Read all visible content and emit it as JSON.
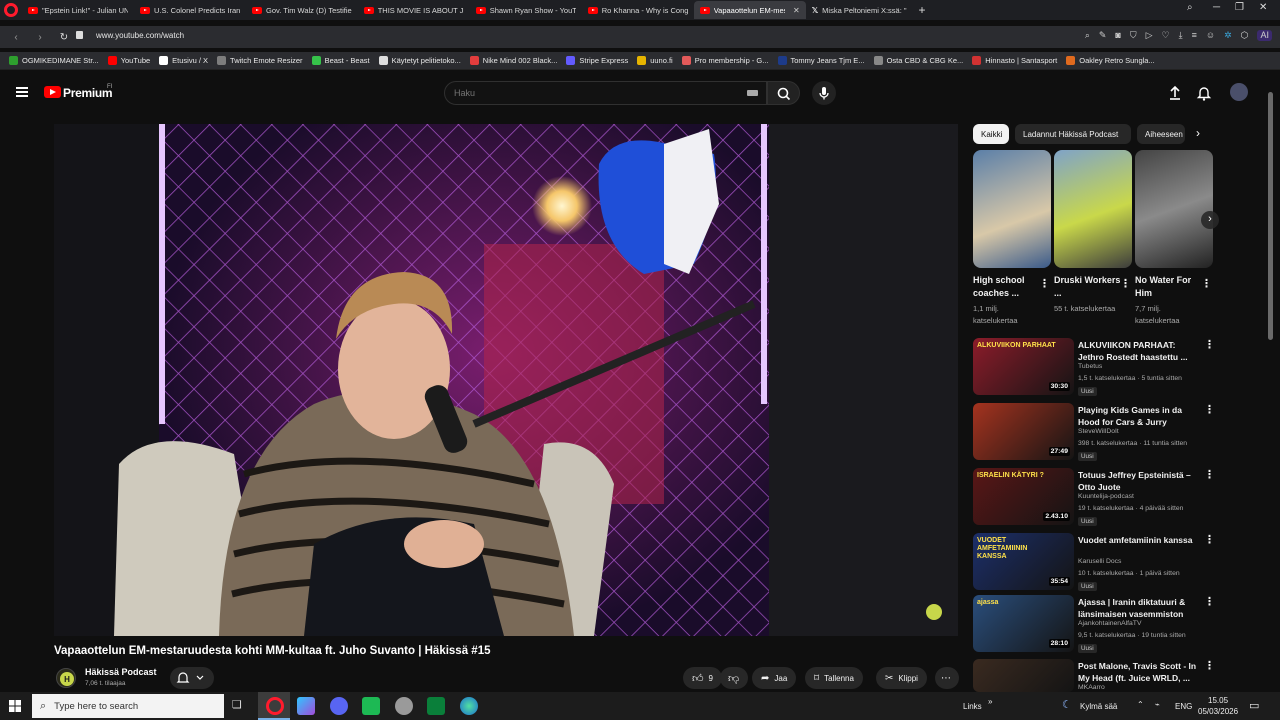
{
  "browser": {
    "tabs": [
      {
        "label": "\"Epstein Link!\" - Julian UN",
        "kind": "youtube"
      },
      {
        "label": "U.S. Colonel Predicts Iran",
        "kind": "youtube"
      },
      {
        "label": "Gov. Tim Walz (D) Testifie",
        "kind": "youtube"
      },
      {
        "label": "THIS MOVIE IS ABOUT JEF",
        "kind": "youtube"
      },
      {
        "label": "Shawn Ryan Show - YouT",
        "kind": "youtube"
      },
      {
        "label": "Ro Khanna - Why is Cong",
        "kind": "youtube"
      },
      {
        "label": "Vapaaottelun EM-mes",
        "kind": "youtube",
        "active": true
      },
      {
        "label": "Miska Peltoniemi X:ssä: \"",
        "kind": "x"
      }
    ],
    "url": "www.youtube.com/watch",
    "new_tab": "+",
    "ai_label": "AI",
    "bookmarks": [
      {
        "label": "OGMIKEDIMANE Str...",
        "color": "#2e9f2e"
      },
      {
        "label": "YouTube",
        "color": "#ff0000"
      },
      {
        "label": "Etusivu / X",
        "color": "#ffffff"
      },
      {
        "label": "Twitch Emote Resizer",
        "color": "#7d7d7d"
      },
      {
        "label": "Beast - Beast",
        "color": "#36c24a"
      },
      {
        "label": "Käytetyt pelitietoko...",
        "color": "#dddddd"
      },
      {
        "label": "Nike Mind 002 Black...",
        "color": "#e23d3d"
      },
      {
        "label": "Stripe Express",
        "color": "#635bff"
      },
      {
        "label": "uuno.fi",
        "color": "#e6b400"
      },
      {
        "label": "Pro membership - G...",
        "color": "#e35a5a"
      },
      {
        "label": "Tommy Jeans Tjm E...",
        "color": "#1d3b8a"
      },
      {
        "label": "Osta CBD & CBG Ke...",
        "color": "#888888"
      },
      {
        "label": "Hinnasto | Santasport",
        "color": "#d13232"
      },
      {
        "label": "Oakley Retro Sungla...",
        "color": "#e06a1e"
      }
    ]
  },
  "youtube": {
    "brand": "Premium",
    "brand_region": "FI",
    "search_placeholder": "Haku"
  },
  "video": {
    "title": "Vapaaottelun EM-mestaruudesta kohti MM-kultaa ft. Juho Suvanto | Häkissä #15",
    "channel": "Häkissä Podcast",
    "subscribers": "7,06 t. tilaajaa",
    "likes": "9",
    "share": "Jaa",
    "save": "Tallenna",
    "clip": "Klippi"
  },
  "chips": [
    {
      "label": "Kaikki",
      "selected": true
    },
    {
      "label": "Ladannut Häkissä Podcast",
      "selected": false
    },
    {
      "label": "Aiheeseen",
      "selected": false
    }
  ],
  "shorts": [
    {
      "title": "High school coaches ...",
      "views": "1,1 milj. katselukertaa"
    },
    {
      "title": "Druski Workers ...",
      "views": "55 t. katselukertaa"
    },
    {
      "title": "No Water For Him",
      "views": "7,7 milj. katselukertaa"
    }
  ],
  "recommendations": [
    {
      "title": "ALKUVIIKON PARHAAT: Jethro Rostedt haastettu ...",
      "channel": "Tubetus",
      "meta": "1,5 t. katselukertaa · 5 tuntia sitten",
      "badge": "Uusi",
      "duration": "30:30",
      "thumb": "#8c1c2a",
      "thumb_text": "ALKUVIIKON PARHAAT"
    },
    {
      "title": "Playing Kids Games in da Hood for Cars & Jurry",
      "channel": "SteveWillDoIt",
      "meta": "398 t. katselukertaa · 11 tuntia sitten",
      "badge": "Uusi",
      "duration": "27:49",
      "thumb": "#a5331f",
      "thumb_text": ""
    },
    {
      "title": "Totuus Jeffrey Epsteinistä – Otto Juote",
      "channel": "Kuuntelija-podcast",
      "meta": "19 t. katselukertaa · 4 päivää sitten",
      "badge": "Uusi",
      "duration": "2.43.10",
      "thumb": "#5a1616",
      "thumb_text": "ISRAELIN KÄTYRI ?"
    },
    {
      "title": "Vuodet amfetamiinin kanssa",
      "channel": "Karuselli Docs",
      "meta": "10 t. katselukertaa · 1 päivä sitten",
      "badge": "Uusi",
      "duration": "35:54",
      "thumb": "#1c2f6a",
      "thumb_text": "VUODET AMFETAMIININ KANSSA"
    },
    {
      "title": "Ajassa | Iranin diktatuuri & länsimaisen vasemmiston tuk...",
      "channel": "AjankohtainenAlfaTV",
      "meta": "9,5 t. katselukertaa · 19 tuntia sitten",
      "badge": "Uusi",
      "duration": "28:10",
      "thumb": "#2a4e7c",
      "thumb_text": "ajassa"
    },
    {
      "title": "Post Malone, Travis Scott - In My Head (ft. Juice WRLD, ...",
      "channel": "MKAarro",
      "meta": "",
      "badge": "",
      "duration": "",
      "thumb": "#3a2a20",
      "thumb_text": ""
    }
  ],
  "taskbar": {
    "search_placeholder": "Type here to search",
    "links": "Links",
    "weather": "Kylmä sää",
    "lang": "ENG",
    "time": "15.05",
    "date": "05/03/2026"
  }
}
